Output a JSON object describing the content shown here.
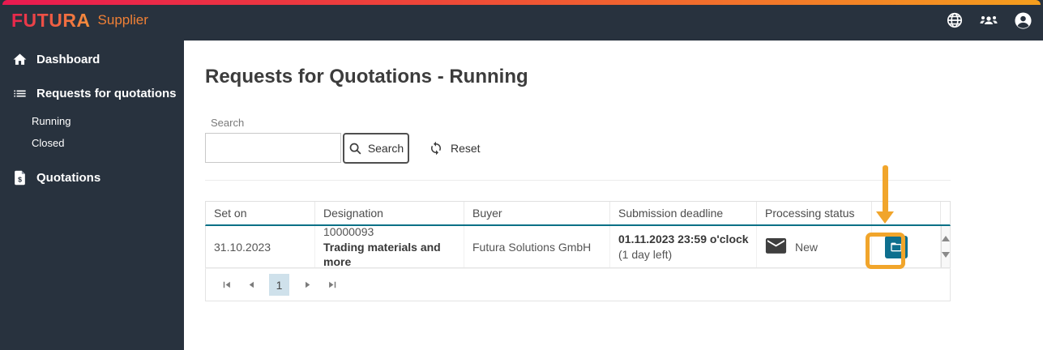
{
  "colors": {
    "nav_bg": "#28323e",
    "accent_teal": "#0e6f8e",
    "header_border_teal": "#0b7086",
    "annotation_orange": "#f1a52b",
    "brand_gradient_start": "#e8254c",
    "brand_gradient_end": "#f5903c",
    "supplier_orange": "#f08036",
    "page_badge_bg": "#cfe1eb"
  },
  "topbar": {
    "brand": "FUTURA",
    "product": "Supplier",
    "icons": [
      "globe-icon",
      "users-icon",
      "account-icon"
    ]
  },
  "sidebar": {
    "dashboard": "Dashboard",
    "requests": "Requests for quotations",
    "running": "Running",
    "closed": "Closed",
    "quotations": "Quotations"
  },
  "main": {
    "title": "Requests for Quotations - Running",
    "search": {
      "label": "Search",
      "value": "",
      "search_button": "Search",
      "reset_button": "Reset"
    },
    "table": {
      "columns": [
        "Set on",
        "Designation",
        "Buyer",
        "Submission deadline",
        "Processing status",
        ""
      ],
      "rows": [
        {
          "set_on": "31.10.2023",
          "designation_id": "10000093",
          "designation_name": "Trading materials and more",
          "buyer": "Futura Solutions GmbH",
          "deadline": "01.11.2023 23:59 o'clock",
          "deadline_note": "(1 day left)",
          "status": "New",
          "status_icon": "mail-icon",
          "action_icon": "folder-open-icon"
        }
      ]
    },
    "pagination": {
      "current_page": "1"
    }
  }
}
